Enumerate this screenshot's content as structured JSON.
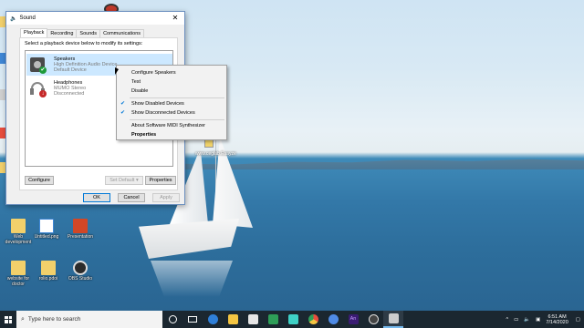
{
  "desktop": {
    "icons": [
      {
        "label": "Web development",
        "color": "#f2d06b"
      },
      {
        "label": "Untitled.png",
        "color": "#3f87d6"
      },
      {
        "label": "Presentation",
        "color": "#cfcfcf"
      },
      {
        "label": "website for doctor",
        "color": "#f2d06b"
      },
      {
        "label": "rolio.pdoi",
        "color": "#f2d06b"
      },
      {
        "label": "OBS Studio",
        "color": "#2b2b2b"
      }
    ],
    "watermark_text": "www.ceglab.Eaayze"
  },
  "sound_dialog": {
    "title": "Sound",
    "tabs": [
      "Playback",
      "Recording",
      "Sounds",
      "Communications"
    ],
    "active_tab": "Playback",
    "instruction": "Select a playback device below to modify its settings:",
    "devices": [
      {
        "name": "Speakers",
        "driver": "High Definition Audio Device",
        "status": "Default Device",
        "badge_color": "#1e9a3a",
        "badge_symbol": "✔",
        "selected": true
      },
      {
        "name": "Headphones",
        "driver": "MUMO Stereo",
        "status": "Disconnected",
        "badge_color": "#c62828",
        "badge_symbol": "↓",
        "selected": false
      }
    ],
    "buttons": {
      "configure": "Configure",
      "set_default": "Set Default",
      "set_default_arrow": "▾",
      "properties": "Properties",
      "ok": "OK",
      "cancel": "Cancel",
      "apply": "Apply"
    },
    "close_symbol": "✕"
  },
  "context_menu": {
    "items": [
      {
        "label": "Configure Speakers",
        "checked": false,
        "bold": false
      },
      {
        "label": "Test",
        "checked": false,
        "bold": false
      },
      {
        "label": "Disable",
        "checked": false,
        "bold": false
      },
      {
        "label": "Show Disabled Devices",
        "checked": true,
        "bold": false
      },
      {
        "label": "Show Disconnected Devices",
        "checked": true,
        "bold": false
      },
      {
        "label": "About Software MIDI Synthesizer",
        "checked": false,
        "bold": false
      },
      {
        "label": "Properties",
        "checked": false,
        "bold": true
      }
    ],
    "check_symbol": "✔"
  },
  "taskbar": {
    "search_placeholder": "Type here to search",
    "apps": [
      {
        "name": "cortana",
        "color": "#ffffff"
      },
      {
        "name": "task-view",
        "color": "#ffffff"
      },
      {
        "name": "edge",
        "color": "#2f7fd8"
      },
      {
        "name": "file-explorer",
        "color": "#f4c542"
      },
      {
        "name": "store",
        "color": "#e6e6e6"
      },
      {
        "name": "camtasia",
        "color": "#2e9e58"
      },
      {
        "name": "filmora",
        "color": "#3fd1c6"
      },
      {
        "name": "chrome",
        "color": "#e84d3d"
      },
      {
        "name": "chrome-alt",
        "color": "#4f8be6"
      },
      {
        "name": "animate",
        "color": "#3a1c72"
      },
      {
        "name": "obs",
        "color": "#444444"
      },
      {
        "name": "sound",
        "color": "#cccccc"
      }
    ],
    "animate_label": "An",
    "tray": {
      "chevron": "^",
      "time": "6:51 AM",
      "date": "7/14/2020"
    }
  }
}
